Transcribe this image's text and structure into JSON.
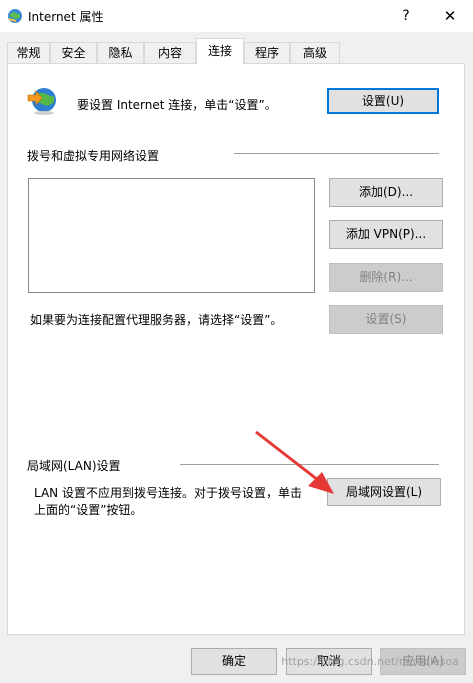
{
  "window": {
    "title": "Internet 属性",
    "help": "?",
    "close": "✕",
    "icon": "internet-options-globe-icon"
  },
  "tabs": [
    "常规",
    "安全",
    "隐私",
    "内容",
    "连接",
    "程序",
    "高级"
  ],
  "active_tab": "连接",
  "setup": {
    "text": "要设置 Internet 连接，单击“设置”。",
    "button": "设置(U)"
  },
  "dialup": {
    "group_label": "拨号和虚拟专用网络设置",
    "add_button": "添加(D)...",
    "add_vpn_button": "添加 VPN(P)...",
    "remove_button": "删除(R)...",
    "proxy_text": "如果要为连接配置代理服务器，请选择“设置”。",
    "settings_button": "设置(S)"
  },
  "lan": {
    "group_label": "局域网(LAN)设置",
    "text_line1": "LAN 设置不应用到拨号连接。对于拨号设置，单击",
    "text_line2": "上面的“设置”按钮。",
    "button": "局域网设置(L)"
  },
  "footer": {
    "ok": "确定",
    "cancel": "取消",
    "apply": "应用(A)"
  },
  "watermark": "https://blog.csdn.net/miraclesoa",
  "colors": {
    "arrow": "#e53935",
    "focus_border": "#0078d7"
  }
}
